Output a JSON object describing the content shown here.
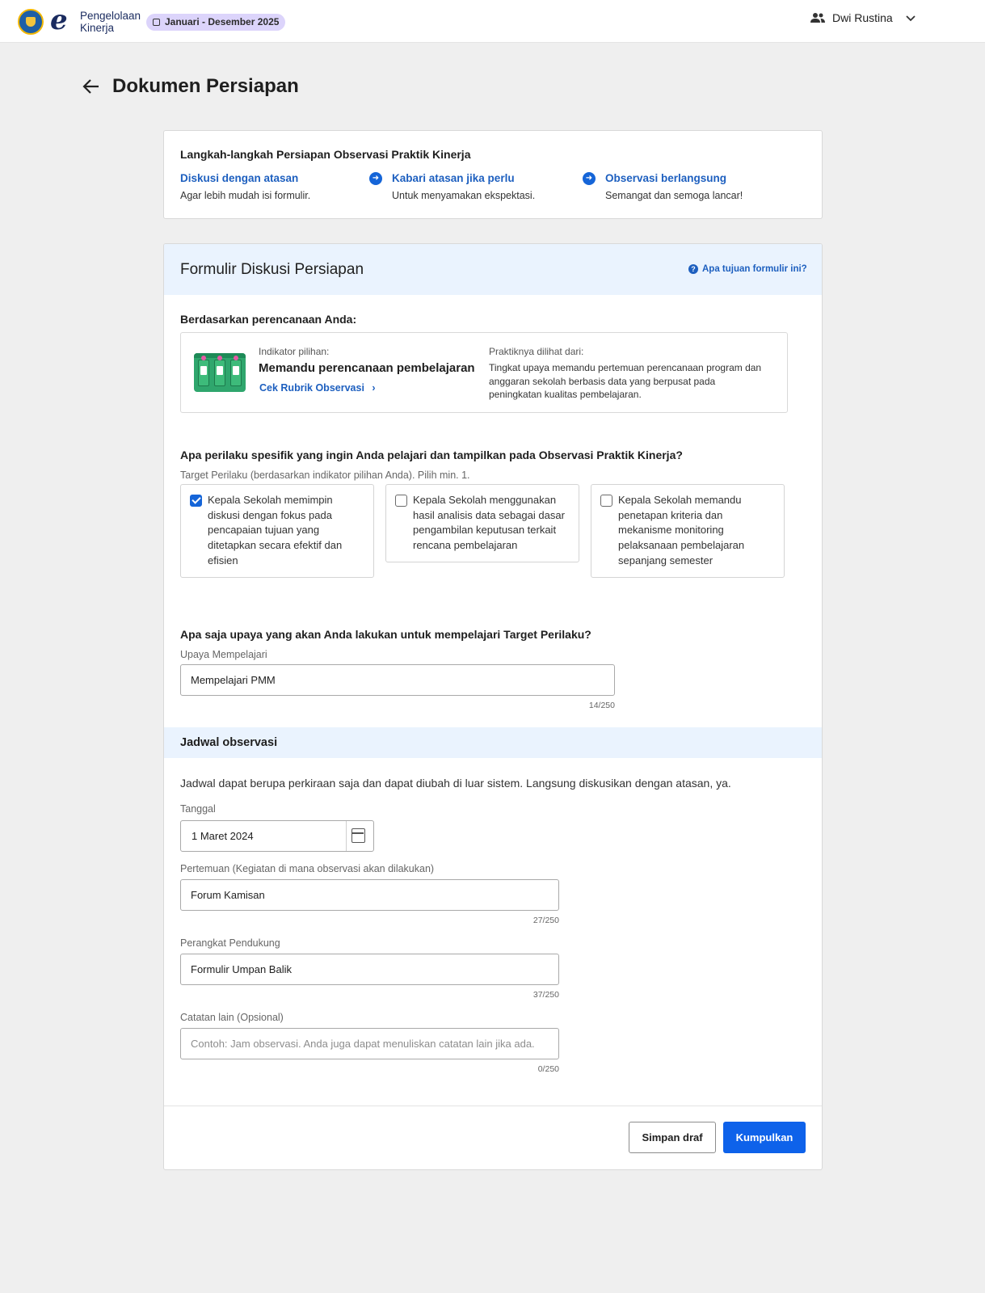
{
  "header": {
    "brand_line1": "Pengelolaan",
    "brand_line2": "Kinerja",
    "period": "Januari - Desember 2025",
    "user_name": "Dwi Rustina"
  },
  "page": {
    "title": "Dokumen Persiapan"
  },
  "steps": {
    "title": "Langkah-langkah Persiapan Observasi Praktik Kinerja",
    "items": [
      {
        "label": "Diskusi dengan atasan",
        "desc": "Agar lebih mudah isi formulir."
      },
      {
        "label": "Kabari atasan jika perlu",
        "desc": "Untuk menyamakan ekspektasi."
      },
      {
        "label": "Observasi berlangsung",
        "desc": "Semangat dan semoga lancar!"
      }
    ]
  },
  "form": {
    "title": "Formulir Diskusi Persiapan",
    "help_link": "Apa tujuan formulir ini?",
    "planning_heading": "Berdasarkan perencanaan Anda:",
    "indicator": {
      "label": "Indikator pilihan:",
      "title": "Memandu perencanaan pembelajaran",
      "link": "Cek Rubrik Observasi",
      "practice_label": "Praktiknya dilihat dari:",
      "practice_desc": "Tingkat upaya memandu pertemuan perencanaan program dan anggaran sekolah berbasis data yang berpusat pada peningkatan kualitas pembelajaran."
    },
    "behavior_question": "Apa perilaku spesifik yang ingin Anda pelajari dan tampilkan pada Observasi Praktik Kinerja?",
    "behavior_hint": "Target Perilaku (berdasarkan indikator pilihan Anda). Pilih min. 1.",
    "behaviors": [
      {
        "text": "Kepala Sekolah memimpin diskusi dengan fokus pada pencapaian tujuan yang ditetapkan secara efektif dan efisien",
        "checked": true
      },
      {
        "text": "Kepala Sekolah menggunakan hasil analisis data sebagai dasar pengambilan keputusan terkait rencana pembelajaran",
        "checked": false
      },
      {
        "text": "Kepala Sekolah memandu penetapan kriteria dan mekanisme monitoring pelaksanaan pembelajaran sepanjang semester",
        "checked": false
      }
    ],
    "effort_question": "Apa saja upaya yang akan Anda lakukan untuk mempelajari Target Perilaku?",
    "effort_label": "Upaya Mempelajari",
    "effort_value": "Mempelajari PMM",
    "effort_counter": "14/250",
    "schedule": {
      "title": "Jadwal observasi",
      "note": "Jadwal dapat berupa perkiraan saja dan dapat diubah di luar sistem. Langsung diskusikan dengan atasan, ya.",
      "date_label": "Tanggal",
      "date_value": "1 Maret 2024",
      "meeting_label": "Pertemuan (Kegiatan di mana observasi akan dilakukan)",
      "meeting_value": "Forum Kamisan",
      "meeting_counter": "27/250",
      "tool_label": "Perangkat Pendukung",
      "tool_value": "Formulir Umpan Balik",
      "tool_counter": "37/250",
      "notes_label": "Catatan lain (Opsional)",
      "notes_placeholder": "Contoh: Jam observasi. Anda juga dapat menuliskan catatan lain jika ada.",
      "notes_counter": "0/250"
    },
    "buttons": {
      "save_draft": "Simpan draf",
      "submit": "Kumpulkan"
    }
  },
  "colors": {
    "primary": "#0e62ea",
    "link": "#1d5fbf",
    "header_band": "#eaf3fe",
    "period_chip": "#dcd4fb"
  }
}
